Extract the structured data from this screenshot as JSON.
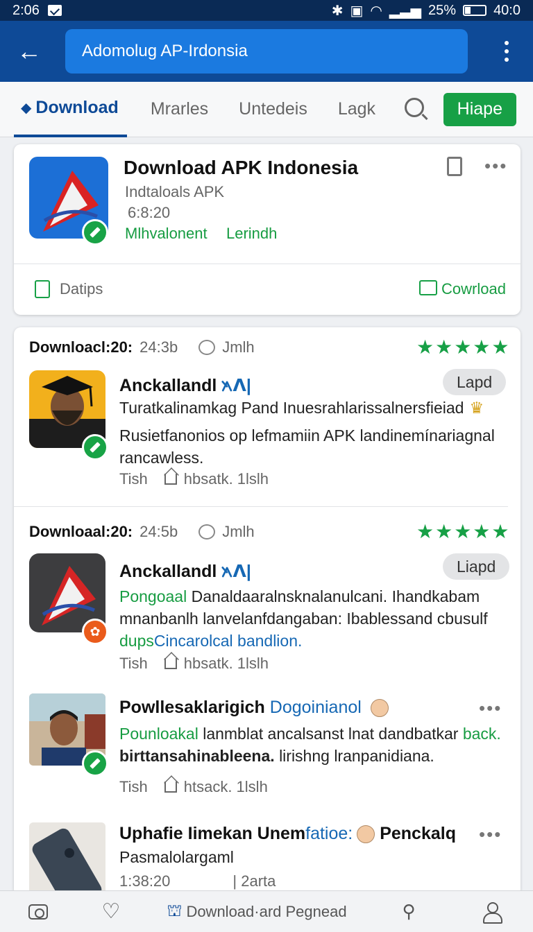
{
  "status": {
    "time": "2:06",
    "battery": "25%",
    "clock": "40:0",
    "battery_level": 0.25
  },
  "appbar": {
    "search_text": "Adomolug AP-Irdonsia"
  },
  "tabs": [
    {
      "label": "Download"
    },
    {
      "label": "Mrarles"
    },
    {
      "label": "Untedeis"
    },
    {
      "label": "Lagk"
    }
  ],
  "header_button": "Hiape",
  "main_card": {
    "title": "Download APK Indonesia",
    "subtitle": "Indtaloals APK",
    "size": "6:8:20",
    "tag1": "Mlhvalonent",
    "tag2": "Lerindh",
    "details_label": "Datips",
    "download_label": "Cowrload"
  },
  "reviews": [
    {
      "head_bold": "Downloacl:20:",
      "head_time": "24:3b",
      "head_user": "Jmlh",
      "stars": "★★★★★",
      "name": "Anckallandl",
      "name_suffix": "᭶ᐱ|",
      "pill": "Lapd",
      "line1": "Turatkalinamkag Pand Inuesrahlarissalnersfieiad",
      "link": "Rusietfanonios op lefmamiin APK landinemínariagnal rancawless.",
      "meta_left": "Tish",
      "meta_right": "hbsatk. 1lslh"
    },
    {
      "head_bold": "Downloaal:20:",
      "head_time": "24:5b",
      "head_user": "Jmlh",
      "stars": "★★★★★",
      "name": "Anckallandl",
      "name_suffix": "᭶ᐱ|",
      "pill": "Liapd",
      "green_lead": "Pongoaal",
      "body": "Danaldaaralnsknalanulcani. Ihandkabam mnanbanlh lanvelanfdangaban: Ibablessand cbusulf",
      "tail_green": "dups",
      "tail_blue": "Cincarolcal bandlion.",
      "meta_left": "Tish",
      "meta_right": "hbsatk. 1lslh"
    },
    {
      "name": "Powllesaklarigich",
      "name_blue": "Dogoinianol",
      "green_lead": "Pounloakal",
      "body": "lanmblat ancalsanst lnat dandbatkar",
      "tail_green": "back.",
      "tail_bold": "birttansahinableena.",
      "tail_rest": "lirishng lranpanidiana.",
      "meta_left": "Tish",
      "meta_right": "htsack. 1lslh"
    },
    {
      "name": "Uphafie Iimekan Unem",
      "name_blue": "fatioe:",
      "name_tail": "Penckalq",
      "link": "Pasmalolargaml",
      "time": "1:38:20",
      "meta_right": "| 2arta"
    }
  ],
  "bottom_nav": {
    "center_label": "Download·ard Pegnead"
  },
  "colors": {
    "primary": "#0e4a97",
    "accent_green": "#17a046",
    "link_blue": "#1668b4",
    "status_bar": "#0a2a55"
  }
}
